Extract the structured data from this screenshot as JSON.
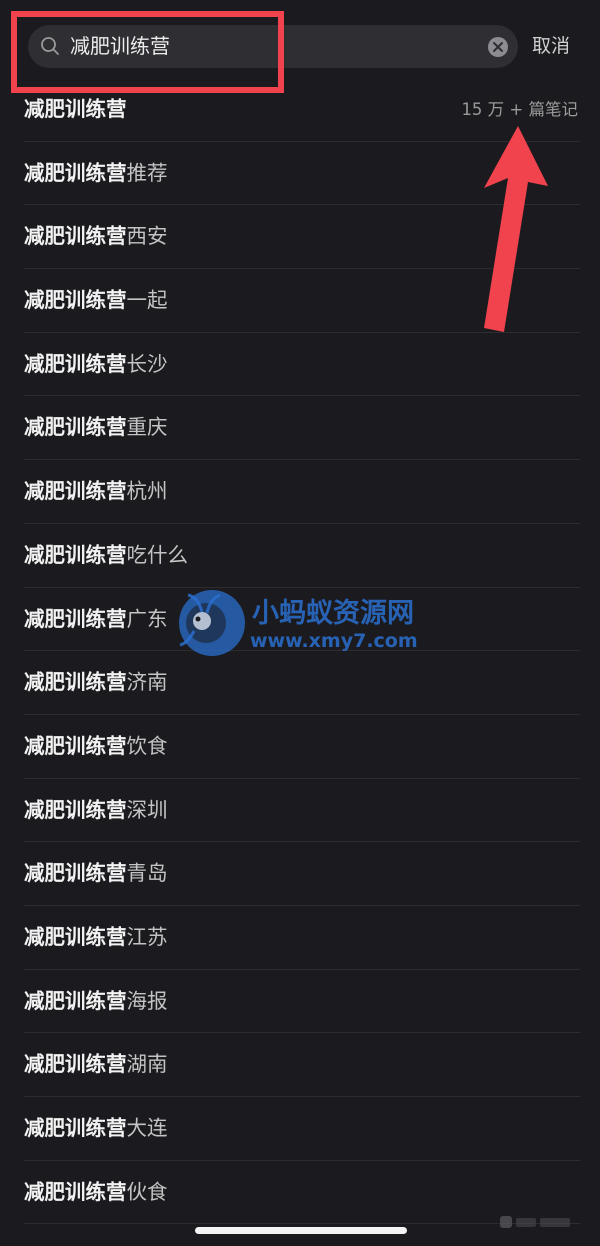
{
  "search": {
    "query": "减肥训练营",
    "cancel_label": "取消"
  },
  "suggestions": [
    {
      "main": "减肥训练营",
      "suffix": "",
      "count": "15 万 + 篇笔记"
    },
    {
      "main": "减肥训练营",
      "suffix": "推荐"
    },
    {
      "main": "减肥训练营",
      "suffix": "西安"
    },
    {
      "main": "减肥训练营",
      "suffix": "一起"
    },
    {
      "main": "减肥训练营",
      "suffix": "长沙"
    },
    {
      "main": "减肥训练营",
      "suffix": "重庆"
    },
    {
      "main": "减肥训练营",
      "suffix": "杭州"
    },
    {
      "main": "减肥训练营",
      "suffix": "吃什么"
    },
    {
      "main": "减肥训练营",
      "suffix": "广东"
    },
    {
      "main": "减肥训练营",
      "suffix": "济南"
    },
    {
      "main": "减肥训练营",
      "suffix": "饮食"
    },
    {
      "main": "减肥训练营",
      "suffix": "深圳"
    },
    {
      "main": "减肥训练营",
      "suffix": "青岛"
    },
    {
      "main": "减肥训练营",
      "suffix": "江苏"
    },
    {
      "main": "减肥训练营",
      "suffix": "海报"
    },
    {
      "main": "减肥训练营",
      "suffix": "湖南"
    },
    {
      "main": "减肥训练营",
      "suffix": "大连"
    },
    {
      "main": "减肥训练营",
      "suffix": "伙食"
    }
  ],
  "watermark": {
    "title": "小蚂蚁资源网",
    "url": "www.xmy7.com"
  },
  "colors": {
    "background": "#1b1b1f",
    "annotation_red": "#f0434e",
    "watermark_blue": "#2a6fcf"
  },
  "icons": {
    "search": "search-icon",
    "clear": "clear-icon",
    "arrow": "arrow-up-icon"
  }
}
